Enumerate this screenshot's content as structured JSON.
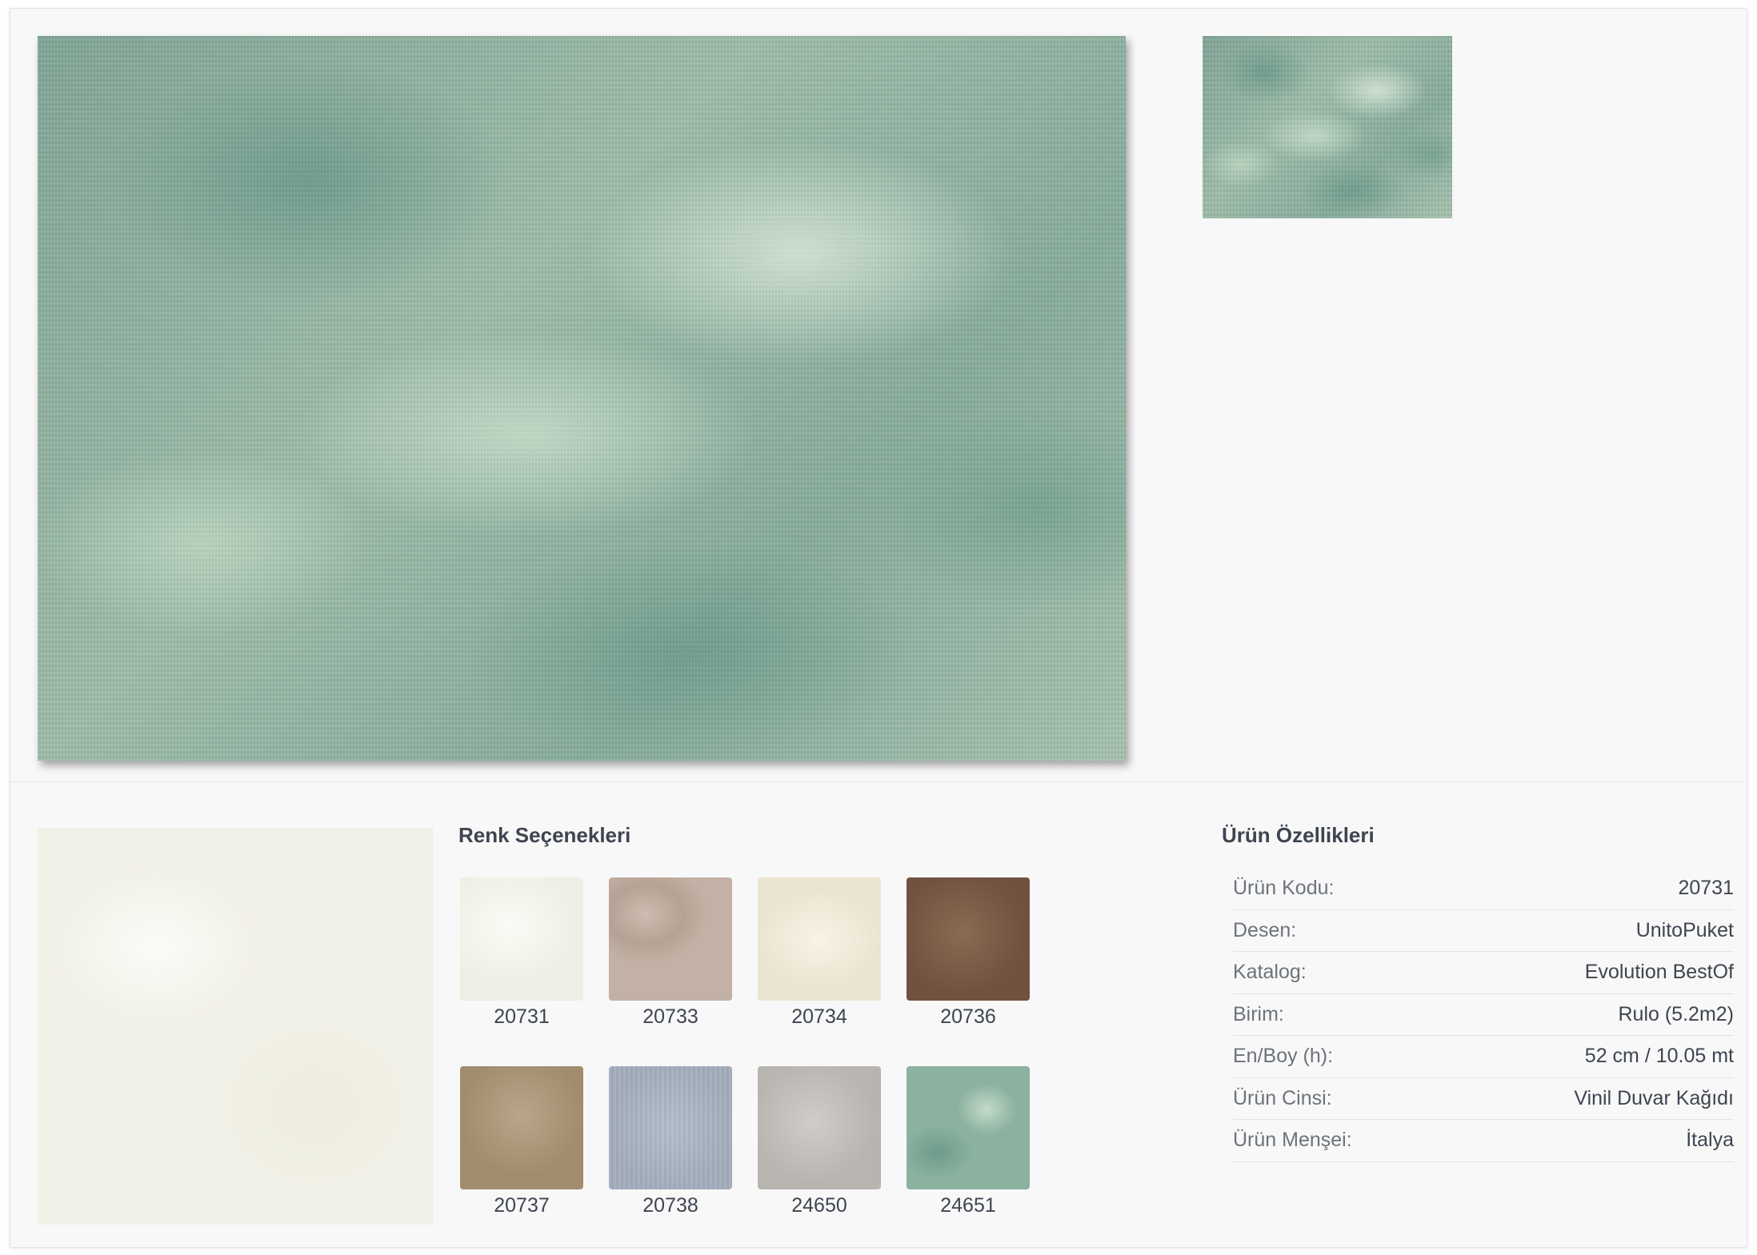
{
  "colors_section": {
    "title": "Renk Seçenekleri",
    "swatches": [
      {
        "code": "20731"
      },
      {
        "code": "20733"
      },
      {
        "code": "20734"
      },
      {
        "code": "20736"
      },
      {
        "code": "20737"
      },
      {
        "code": "20738"
      },
      {
        "code": "24650"
      },
      {
        "code": "24651"
      }
    ]
  },
  "specs_section": {
    "title": "Ürün Özellikleri",
    "rows": [
      {
        "key": "Ürün Kodu:",
        "value": "20731"
      },
      {
        "key": "Desen:",
        "value": "UnitoPuket"
      },
      {
        "key": "Katalog:",
        "value": "Evolution BestOf"
      },
      {
        "key": "Birim:",
        "value": "Rulo (5.2m2)"
      },
      {
        "key": "En/Boy (h):",
        "value": "52 cm / 10.05 mt"
      },
      {
        "key": "Ürün Cinsi:",
        "value": "Vinil Duvar Kağıdı"
      },
      {
        "key": "Ürün Menşei:",
        "value": "İtalya"
      }
    ]
  }
}
